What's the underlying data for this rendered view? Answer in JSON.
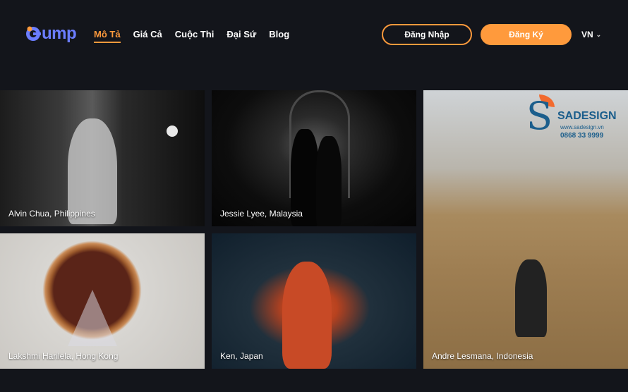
{
  "brand": {
    "logo_text": "ump",
    "colors": {
      "accent": "#ff9a3c",
      "logo": "#6b7dff",
      "background": "#13151b"
    }
  },
  "nav": {
    "items": [
      {
        "label": "Mô Tả",
        "active": true
      },
      {
        "label": "Giá Cả"
      },
      {
        "label": "Cuộc Thi"
      },
      {
        "label": "Đại Sứ"
      },
      {
        "label": "Blog"
      }
    ]
  },
  "actions": {
    "login_label": "Đăng Nhập",
    "register_label": "Đăng Ký"
  },
  "language": {
    "current": "VN",
    "icon": "chevron-down-icon"
  },
  "gallery": {
    "photos": [
      {
        "caption": "Alvin Chua, Philippines"
      },
      {
        "caption": "Jessie Lyee, Malaysia"
      },
      {
        "caption": "Andre Lesmana, Indonesia"
      },
      {
        "caption": "Lakshmi Harilela, Hong Kong"
      },
      {
        "caption": "Ken, Japan"
      }
    ],
    "watermark": {
      "name": "SADESIGN",
      "url": "www.sadesign.vn",
      "phone": "0868 33 9999"
    }
  }
}
